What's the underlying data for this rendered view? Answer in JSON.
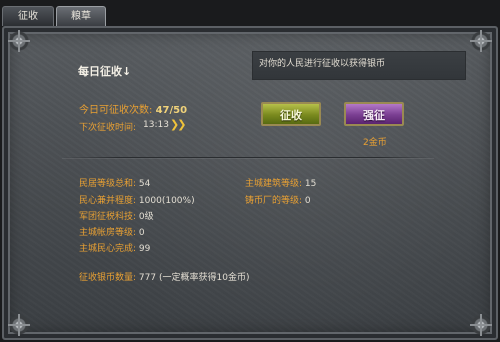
{
  "tabs": [
    "征收",
    "粮草"
  ],
  "title": "每日征收↓",
  "info_text": "对你的人民进行征收以获得银币",
  "daily_count": {
    "label": "今日可征收次数:",
    "value": "47/50"
  },
  "next_levy": {
    "label": "下次征收时间:",
    "value": "13:13"
  },
  "buttons": {
    "levy": "征收",
    "force_levy": "强征"
  },
  "force_cost": "2金币",
  "stats_left": [
    {
      "label": "民居等级总和:",
      "value": "54"
    },
    {
      "label": "民心兼并程度:",
      "value": "1000(100%)"
    },
    {
      "label": "军团征税科技:",
      "value": "0级"
    },
    {
      "label": "主城帐房等级:",
      "value": "0"
    },
    {
      "label": "主城民心完成:",
      "value": "99"
    }
  ],
  "stats_right": [
    {
      "label": "主城建筑等级:",
      "value": "15"
    },
    {
      "label": "铸币厂的等级:",
      "value": "0"
    }
  ],
  "bottom": {
    "label": "征收银币数量:",
    "value": "777",
    "note": "(一定概率获得10金币)"
  }
}
